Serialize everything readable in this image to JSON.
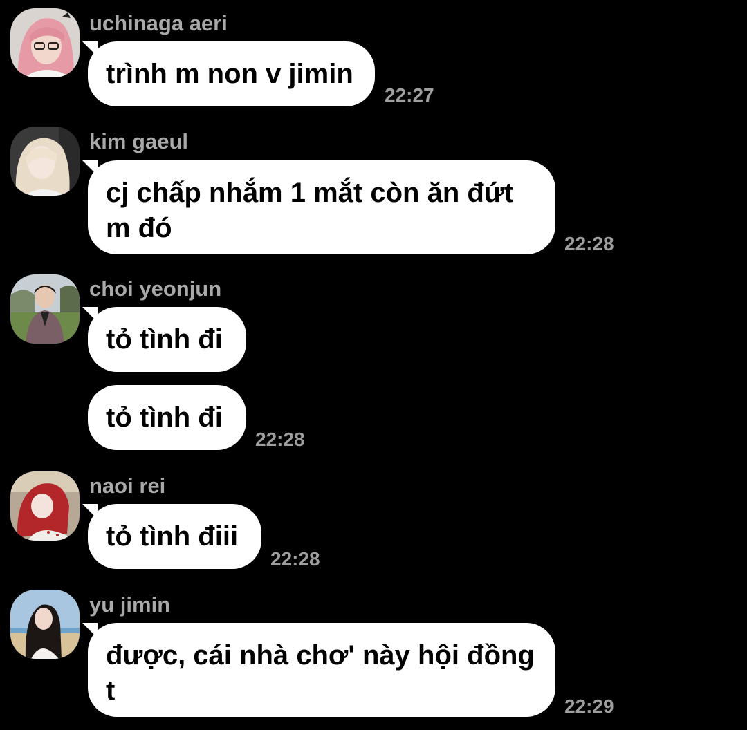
{
  "messages": [
    {
      "sender": "uchinaga aeri",
      "avatar": "avatar-photo-pink-hair",
      "text": "trình m non v jimin",
      "time": "22:27"
    },
    {
      "sender": "kim gaeul",
      "avatar": "avatar-photo-blonde",
      "text": "cj chấp nhắm 1 mắt còn ăn đứt m đó",
      "time": "22:28"
    },
    {
      "sender": "choi yeonjun",
      "avatar": "avatar-photo-park",
      "text": "tỏ tình đi",
      "text2": "tỏ tình đi",
      "time": "22:28"
    },
    {
      "sender": "naoi rei",
      "avatar": "avatar-photo-red-bonnet",
      "text": "tỏ tình điii",
      "time": "22:28"
    },
    {
      "sender": "yu jimin",
      "avatar": "avatar-photo-beach",
      "text": "được, cái nhà chơ' này hội đồng t",
      "time": "22:29"
    }
  ],
  "colors": {
    "background": "#000000",
    "bubble": "#ffffff",
    "sender": "#a9a9a9",
    "timestamp": "#9e9e9e"
  }
}
